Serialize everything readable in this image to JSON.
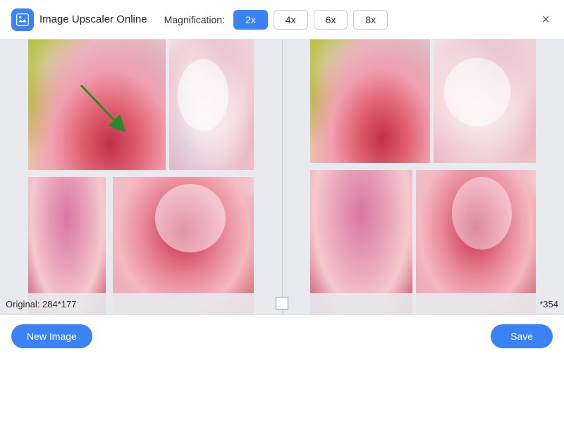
{
  "header": {
    "app_icon_alt": "image-upscaler-icon",
    "app_title": "Image Upscaler Online",
    "magnification_label": "Magnification:",
    "mag_buttons": [
      {
        "label": "2x",
        "value": "2x",
        "active": true
      },
      {
        "label": "4x",
        "value": "4x",
        "active": false
      },
      {
        "label": "6x",
        "value": "6x",
        "active": false
      },
      {
        "label": "8x",
        "value": "8x",
        "active": false
      }
    ],
    "close_label": "×"
  },
  "info_bar": {
    "left_text": "Original: 284*177",
    "right_text": "*354"
  },
  "footer": {
    "new_image_label": "New Image",
    "save_label": "Save"
  },
  "arrow": {
    "color": "#2a8a2a"
  }
}
